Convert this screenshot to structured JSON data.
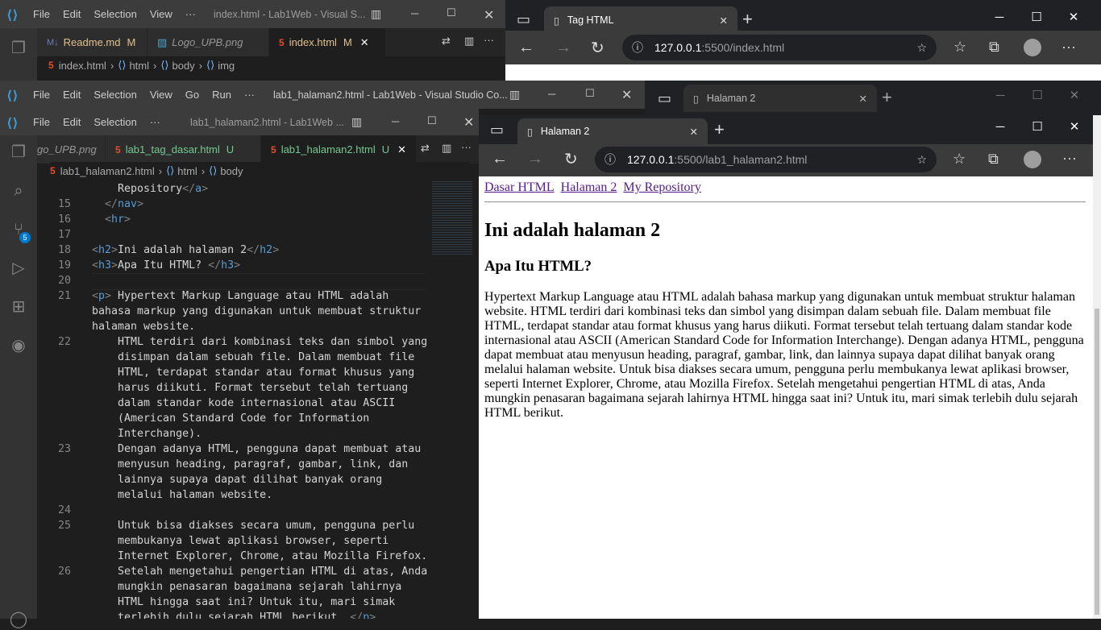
{
  "vscode_back": {
    "menu": [
      "File",
      "Edit",
      "Selection",
      "View",
      "···"
    ],
    "title": "index.html - Lab1Web - Visual S...",
    "tabs": [
      {
        "label": "Readme.md",
        "mod": "M"
      },
      {
        "label": "Logo_UPB.png",
        "mod": ""
      },
      {
        "label": "index.html",
        "mod": "M"
      }
    ],
    "breadcrumb": [
      "index.html",
      "html",
      "body",
      "img"
    ]
  },
  "vscode_mid": {
    "menu": [
      "File",
      "Edit",
      "Selection",
      "View",
      "Go",
      "Run",
      "···"
    ],
    "title": "lab1_halaman2.html - Lab1Web - Visual Studio Co..."
  },
  "vscode_front": {
    "menu": [
      "File",
      "Edit",
      "Selection",
      "···"
    ],
    "title": "lab1_halaman2.html - Lab1Web ...",
    "tabs": [
      {
        "label": "go_UPB.png",
        "mod": ""
      },
      {
        "label": "lab1_tag_dasar.html",
        "mod": "U"
      },
      {
        "label": "lab1_halaman2.html",
        "mod": "U"
      }
    ],
    "breadcrumb": [
      "lab1_halaman2.html",
      "html",
      "body"
    ],
    "scm_badge": "5",
    "code": [
      {
        "n": "",
        "t": "    Repository</a>"
      },
      {
        "n": "15",
        "t": "  </nav>"
      },
      {
        "n": "16",
        "t": "  <hr>"
      },
      {
        "n": "17",
        "t": ""
      },
      {
        "n": "18",
        "t": "<h2>Ini adalah halaman 2</h2>"
      },
      {
        "n": "19",
        "t": "<h3>Apa Itu HTML? </h3>"
      },
      {
        "n": "20",
        "t": ""
      },
      {
        "n": "21",
        "t": "<p> Hypertext Markup Language atau HTML adalah"
      },
      {
        "n": "",
        "t": "bahasa markup yang digunakan untuk membuat struktur"
      },
      {
        "n": "",
        "t": "halaman website."
      },
      {
        "n": "22",
        "t": "    HTML terdiri dari kombinasi teks dan simbol yang"
      },
      {
        "n": "",
        "t": "    disimpan dalam sebuah file. Dalam membuat file"
      },
      {
        "n": "",
        "t": "    HTML, terdapat standar atau format khusus yang"
      },
      {
        "n": "",
        "t": "    harus diikuti. Format tersebut telah tertuang"
      },
      {
        "n": "",
        "t": "    dalam standar kode internasional atau ASCII"
      },
      {
        "n": "",
        "t": "    (American Standard Code for Information"
      },
      {
        "n": "",
        "t": "    Interchange)."
      },
      {
        "n": "23",
        "t": "    Dengan adanya HTML, pengguna dapat membuat atau"
      },
      {
        "n": "",
        "t": "    menyusun heading, paragraf, gambar, link, dan"
      },
      {
        "n": "",
        "t": "    lainnya supaya dapat dilihat banyak orang"
      },
      {
        "n": "",
        "t": "    melalui halaman website."
      },
      {
        "n": "24",
        "t": ""
      },
      {
        "n": "25",
        "t": "    Untuk bisa diakses secara umum, pengguna perlu"
      },
      {
        "n": "",
        "t": "    membukanya lewat aplikasi browser, seperti"
      },
      {
        "n": "",
        "t": "    Internet Explorer, Chrome, atau Mozilla Firefox."
      },
      {
        "n": "26",
        "t": "    Setelah mengetahui pengertian HTML di atas, Anda"
      },
      {
        "n": "",
        "t": "    mungkin penasaran bagaimana sejarah lahirnya"
      },
      {
        "n": "",
        "t": "    HTML hingga saat ini? Untuk itu, mari simak"
      },
      {
        "n": "",
        "t": "    terlebih dulu sejarah HTML berikut. </p>"
      }
    ]
  },
  "edge_back": {
    "tab": "Tag HTML",
    "url_host": "127.0.0.1",
    "url_rest": ":5500/index.html"
  },
  "edge_mid": {
    "tab": "Halaman 2"
  },
  "edge_front": {
    "tab": "Halaman 2",
    "url_host": "127.0.0.1",
    "url_rest": ":5500/lab1_halaman2.html",
    "page": {
      "links": [
        "Dasar HTML",
        "Halaman 2",
        "My Repository"
      ],
      "h2": "Ini adalah halaman 2",
      "h3": "Apa Itu HTML?",
      "p": "Hypertext Markup Language atau HTML adalah bahasa markup yang digunakan untuk membuat struktur halaman website. HTML terdiri dari kombinasi teks dan simbol yang disimpan dalam sebuah file. Dalam membuat file HTML, terdapat standar atau format khusus yang harus diikuti. Format tersebut telah tertuang dalam standar kode internasional atau ASCII (American Standard Code for Information Interchange). Dengan adanya HTML, pengguna dapat membuat atau menyusun heading, paragraf, gambar, link, dan lainnya supaya dapat dilihat banyak orang melalui halaman website. Untuk bisa diakses secara umum, pengguna perlu membukanya lewat aplikasi browser, seperti Internet Explorer, Chrome, atau Mozilla Firefox. Setelah mengetahui pengertian HTML di atas, Anda mungkin penasaran bagaimana sejarah lahirnya HTML hingga saat ini? Untuk itu, mari simak terlebih dulu sejarah HTML berikut."
    }
  },
  "icons": {
    "minimize": "─",
    "maximize": "☐",
    "close": "✕",
    "back": "←",
    "forward": "→",
    "refresh": "↻",
    "info": "ⓘ",
    "more": "···"
  }
}
